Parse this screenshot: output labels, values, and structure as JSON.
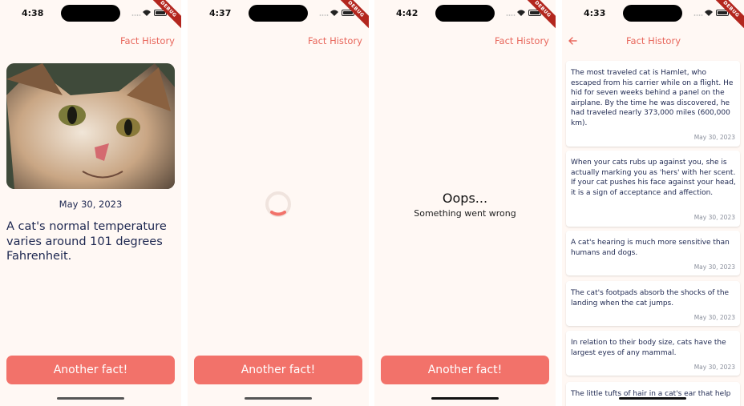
{
  "screens": [
    {
      "time": "4:38",
      "appbar": {
        "history_label": "Fact History"
      },
      "fact": {
        "date": "May 30, 2023",
        "text": "A cat's normal temperature varies around 101 degrees Fahrenheit."
      },
      "button_label": "Another fact!"
    },
    {
      "time": "4:37",
      "appbar": {
        "history_label": "Fact History"
      },
      "button_label": "Another fact!"
    },
    {
      "time": "4:42",
      "appbar": {
        "history_label": "Fact History"
      },
      "error": {
        "title": "Oops...",
        "subtitle": "Something went wrong"
      },
      "button_label": "Another fact!"
    },
    {
      "time": "4:33",
      "appbar": {
        "history_label": "Fact History",
        "back_icon": "arrow-left-icon"
      },
      "history": [
        {
          "text": "The most traveled cat is Hamlet, who escaped from his carrier while on a flight. He hid for seven weeks behind a panel on the airplane. By the time he was discovered, he had traveled nearly 373,000 miles (600,000 km).",
          "date": "May 30, 2023"
        },
        {
          "text": "When your cats rubs up against you, she is actually marking you as 'hers' with her scent. If your cat pushes his face against your head, it is a sign of acceptance and affection.",
          "date": "May 30, 2023"
        },
        {
          "text": "A cat's hearing is much more sensitive than humans and dogs.",
          "date": "May 30, 2023"
        },
        {
          "text": "The cat's footpads absorb the shocks of the landing when the cat jumps.",
          "date": "May 30, 2023"
        },
        {
          "text": "In relation to their body size, cats have the largest eyes of any mammal.",
          "date": "May 30, 2023"
        },
        {
          "text": "The little tufts of hair in a cat's ear that help",
          "date": ""
        }
      ]
    }
  ],
  "debug_banner": "DEBUG",
  "colors": {
    "accent": "#f2726a",
    "link": "#e8675c",
    "text": "#1d2750",
    "background": "#fff8f4"
  }
}
